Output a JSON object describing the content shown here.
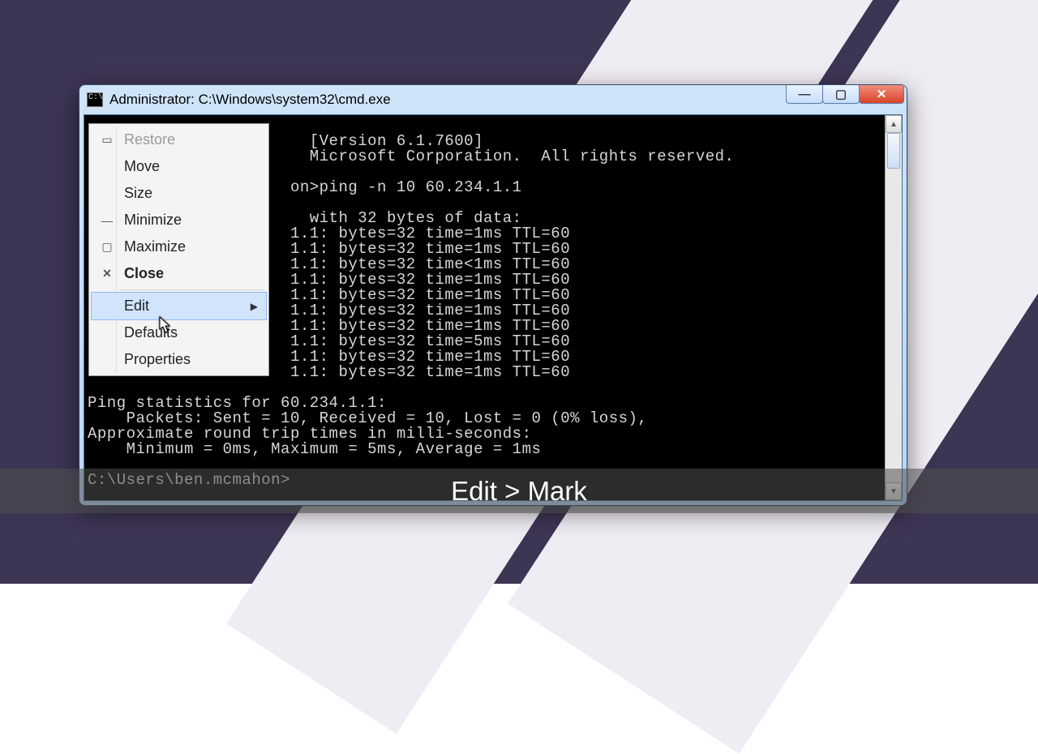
{
  "window": {
    "title": "Administrator: C:\\Windows\\system32\\cmd.exe"
  },
  "terminal": {
    "lines": [
      "                       [Version 6.1.7600]",
      "                       Microsoft Corporation.  All rights reserved.",
      "",
      "                     on>ping -n 10 60.234.1.1",
      "",
      "                       with 32 bytes of data:",
      "                     1.1: bytes=32 time=1ms TTL=60",
      "                     1.1: bytes=32 time=1ms TTL=60",
      "                     1.1: bytes=32 time<1ms TTL=60",
      "                     1.1: bytes=32 time=1ms TTL=60",
      "                     1.1: bytes=32 time=1ms TTL=60",
      "                     1.1: bytes=32 time=1ms TTL=60",
      "                     1.1: bytes=32 time=1ms TTL=60",
      "                     1.1: bytes=32 time=5ms TTL=60",
      "                     1.1: bytes=32 time=1ms TTL=60",
      "                     1.1: bytes=32 time=1ms TTL=60",
      "",
      "Ping statistics for 60.234.1.1:",
      "    Packets: Sent = 10, Received = 10, Lost = 0 (0% loss),",
      "Approximate round trip times in milli-seconds:",
      "    Minimum = 0ms, Maximum = 5ms, Average = 1ms",
      "",
      "C:\\Users\\ben.mcmahon>"
    ]
  },
  "menu": {
    "items": [
      {
        "label": "Restore",
        "icon": "▭",
        "disabled": true,
        "submenu": false
      },
      {
        "label": "Move",
        "icon": "",
        "disabled": false,
        "submenu": false
      },
      {
        "label": "Size",
        "icon": "",
        "disabled": false,
        "submenu": false
      },
      {
        "label": "Minimize",
        "icon": "—",
        "disabled": false,
        "submenu": false
      },
      {
        "label": "Maximize",
        "icon": "▢",
        "disabled": false,
        "submenu": false
      },
      {
        "label": "Close",
        "icon": "✕",
        "disabled": false,
        "submenu": false,
        "bold": true
      },
      {
        "sep": true
      },
      {
        "label": "Edit",
        "icon": "",
        "disabled": false,
        "submenu": true,
        "hover": true
      },
      {
        "label": "Defaults",
        "icon": "",
        "disabled": false,
        "submenu": false
      },
      {
        "label": "Properties",
        "icon": "",
        "disabled": false,
        "submenu": false
      }
    ]
  },
  "caption": {
    "text": "Edit > Mark"
  }
}
